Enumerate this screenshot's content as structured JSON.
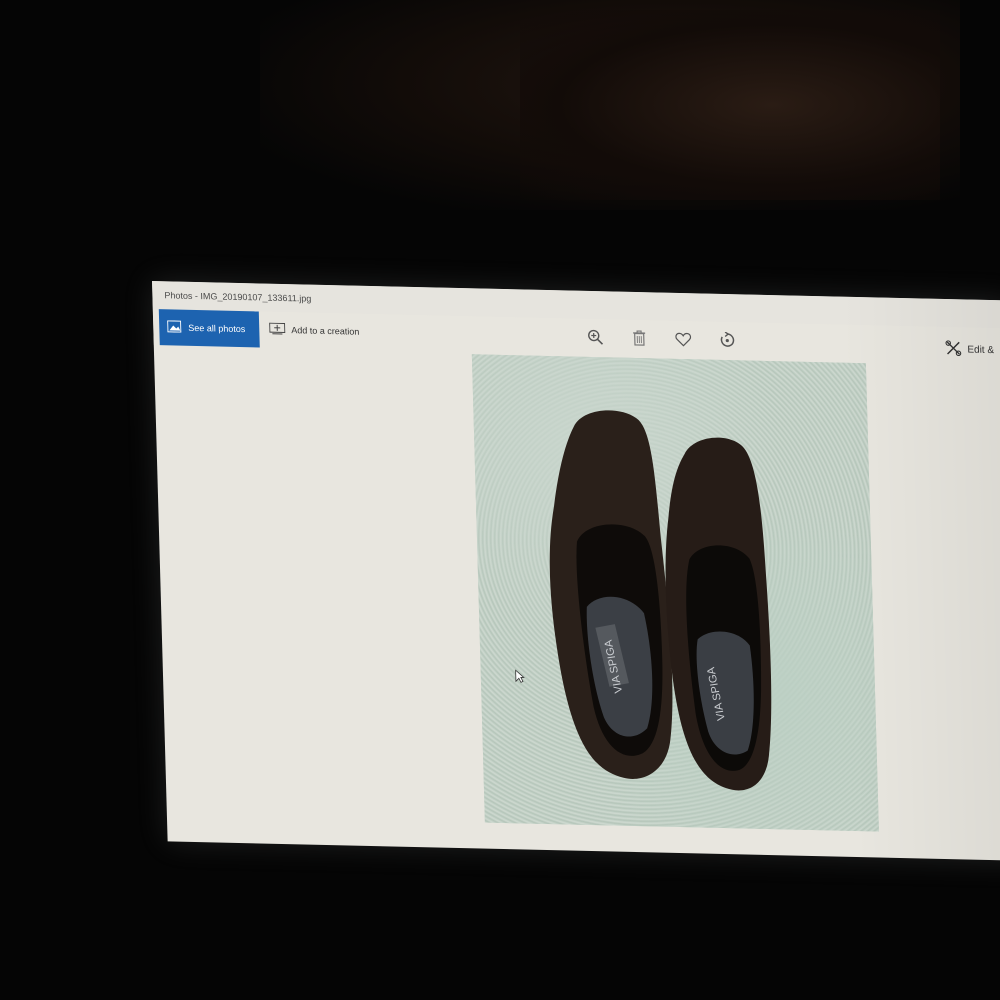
{
  "window": {
    "title": "Photos - IMG_20190107_133611.jpg"
  },
  "toolbar": {
    "see_all_label": "See all photos",
    "add_creation_label": "Add to a creation",
    "edit_label": "Edit &",
    "icons": [
      "zoom-icon",
      "delete-icon",
      "favorite-icon",
      "rotate-icon"
    ]
  },
  "photo": {
    "brand_label": "VIA SPIGA"
  },
  "colors": {
    "accent": "#1d63b0",
    "screen_bg": "#e8e6df"
  }
}
